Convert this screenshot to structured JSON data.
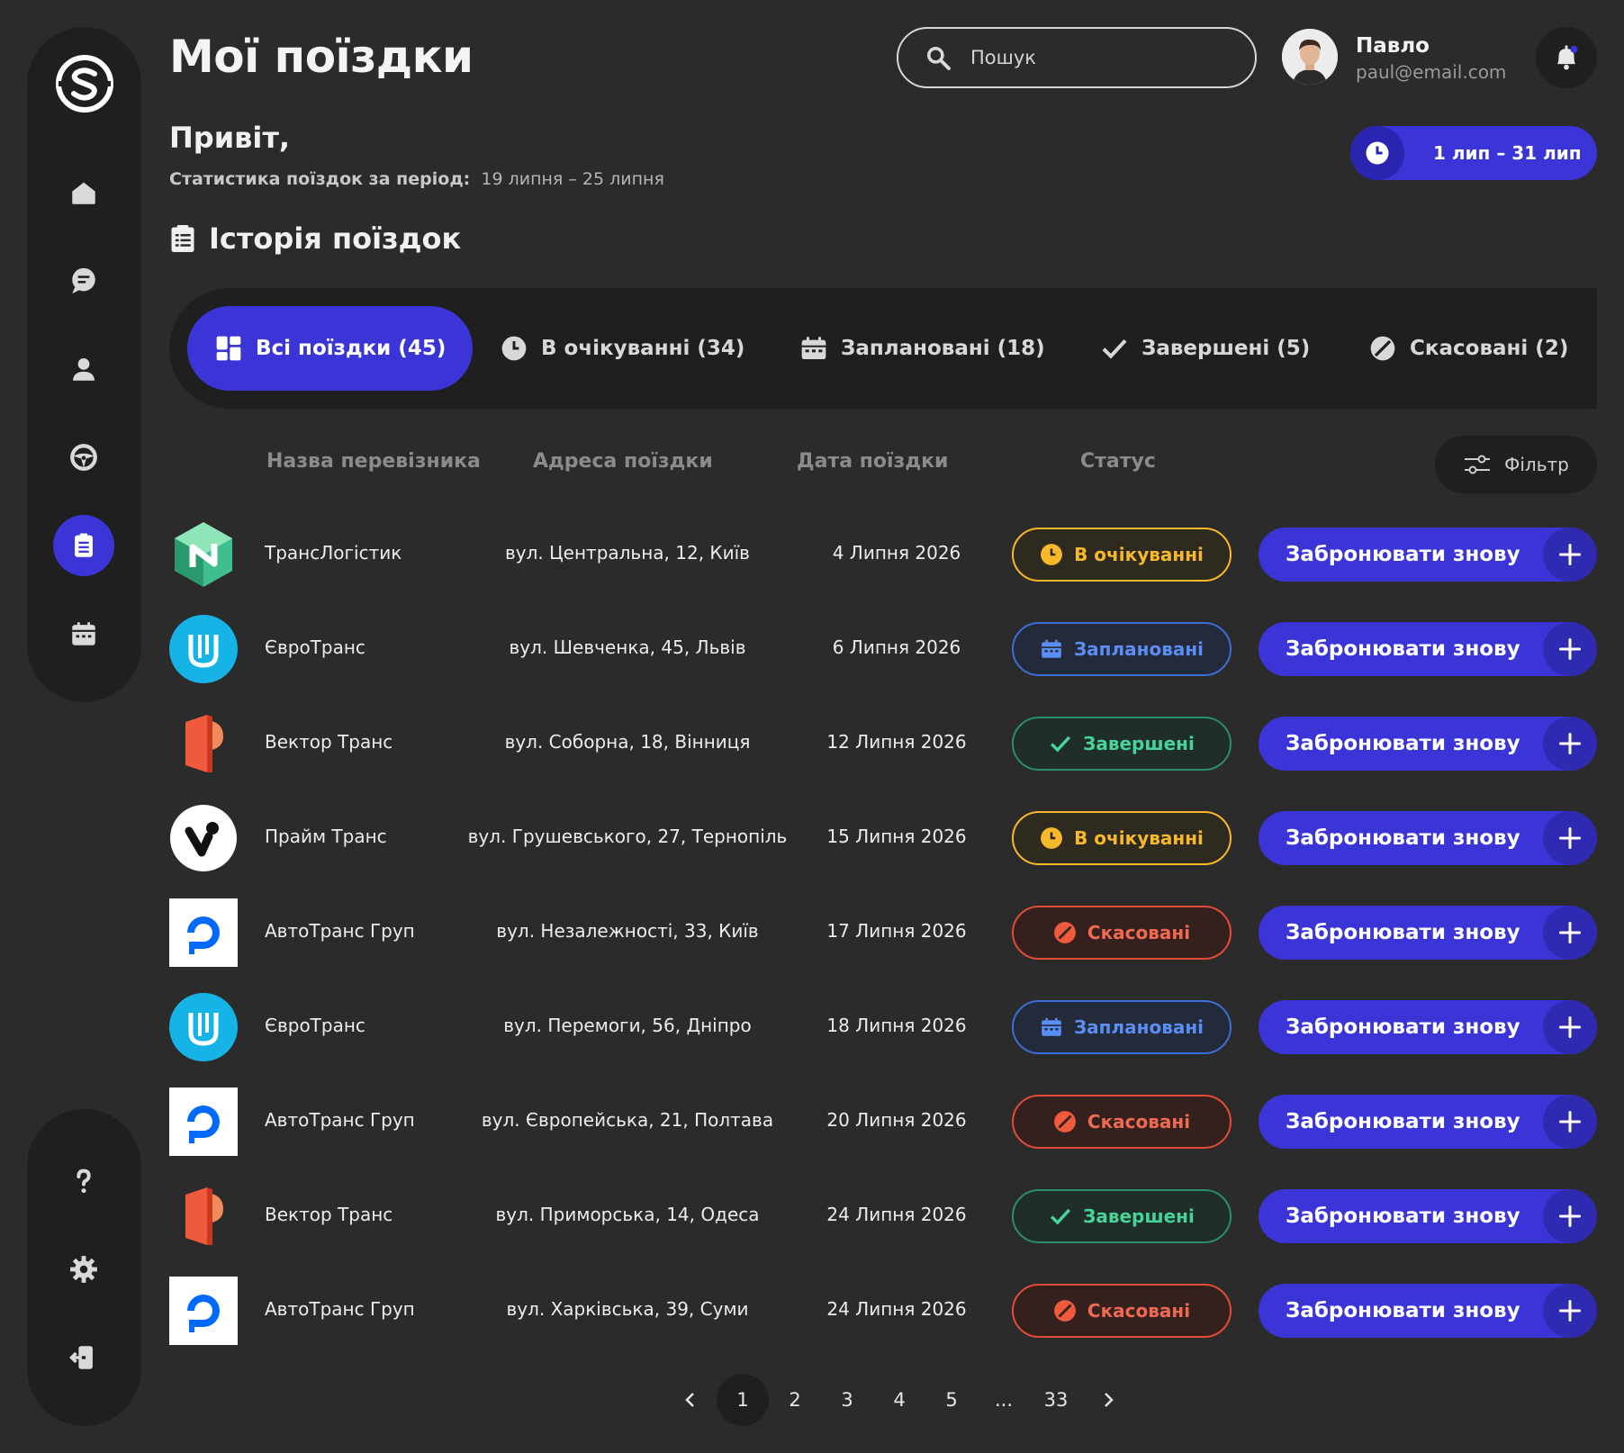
{
  "header": {
    "title": "Мої поїздки",
    "search_placeholder": "Пошук",
    "user_name": "Павло",
    "user_email": "paul@email.com"
  },
  "greeting": "Привіт,",
  "stats_label": "Статистика поїздок за період:",
  "stats_period": "19 липня – 25 липня",
  "date_range": "1 лип – 31 лип",
  "history_title": "Історія поїздок",
  "tabs": [
    {
      "label": "Всі поїздки (45)"
    },
    {
      "label": "В очікуванні (34)"
    },
    {
      "label": "Заплановані (18)"
    },
    {
      "label": "Завершені (5)"
    },
    {
      "label": "Скасовані (2)"
    }
  ],
  "columns": [
    "Назва перевізника",
    "Адреса поїздки",
    "Дата поїздки",
    "Статус"
  ],
  "filter_label": "Фільтр",
  "rebook_label": "Забронювати знову",
  "rows": [
    {
      "carrier": "ТрансЛогістик",
      "address": "вул. Центральна, 12, Київ",
      "date": "4 Липня 2026",
      "status": "В очікуванні",
      "status_type": "pending",
      "logo": "cube-logo"
    },
    {
      "carrier": "ЄвроТранс",
      "address": "вул. Шевченка, 45, Львів",
      "date": "6 Липня 2026",
      "status": "Заплановані",
      "status_type": "planned",
      "logo": "u-logo"
    },
    {
      "carrier": "Вектор Транс",
      "address": "вул. Соборна, 18, Вінниця",
      "date": "12 Липня 2026",
      "status": "Завершені",
      "status_type": "done",
      "logo": "p-logo"
    },
    {
      "carrier": "Прайм Транс",
      "address": "вул. Грушевського, 27, Тернопіль",
      "date": "15 Липня 2026",
      "status": "В очікуванні",
      "status_type": "pending",
      "logo": "v-logo"
    },
    {
      "carrier": "АвтоТранс Груп",
      "address": "вул. Незалежності, 33, Київ",
      "date": "17 Липня 2026",
      "status": "Скасовані",
      "status_type": "cancel",
      "logo": "d-logo"
    },
    {
      "carrier": "ЄвроТранс",
      "address": "вул. Перемоги, 56, Дніпро",
      "date": "18 Липня 2026",
      "status": "Заплановані",
      "status_type": "planned",
      "logo": "u-logo"
    },
    {
      "carrier": "АвтоТранс Груп",
      "address": "вул. Європейська, 21, Полтава",
      "date": "20 Липня 2026",
      "status": "Скасовані",
      "status_type": "cancel",
      "logo": "d-logo"
    },
    {
      "carrier": "Вектор Транс",
      "address": "вул. Приморська, 14, Одеса",
      "date": "24 Липня 2026",
      "status": "Завершені",
      "status_type": "done",
      "logo": "p-logo"
    },
    {
      "carrier": "АвтоТранс Груп",
      "address": "вул. Харківська, 39, Суми",
      "date": "24 Липня 2026",
      "status": "Скасовані",
      "status_type": "cancel",
      "logo": "d-logo"
    }
  ],
  "pagination": [
    "1",
    "2",
    "3",
    "4",
    "5",
    "...",
    "33"
  ],
  "current_page": "1",
  "colors": {
    "accent": "#3b35d8",
    "pending": "#f7b82c",
    "planned": "#5b8ef5",
    "done": "#46d49a",
    "cancel": "#f06a52"
  },
  "icons": {
    "sidebar": [
      "home-icon",
      "chat-icon",
      "user-icon",
      "steering-wheel-icon",
      "clipboard-icon",
      "calendar-icon"
    ],
    "sidebar_bottom": [
      "help-icon",
      "gear-icon",
      "logout-icon"
    ]
  }
}
